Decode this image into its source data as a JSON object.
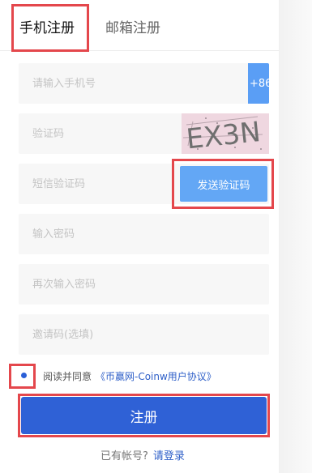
{
  "tabs": [
    {
      "label": "手机注册",
      "active": true
    },
    {
      "label": "邮箱注册",
      "active": false
    }
  ],
  "fields": {
    "phone": {
      "placeholder": "请输入手机号",
      "prefix": "+86"
    },
    "captcha": {
      "placeholder": "验证码",
      "image_text": "EX3N"
    },
    "sms": {
      "placeholder": "短信验证码",
      "button": "发送验证码"
    },
    "password": {
      "placeholder": "输入密码"
    },
    "password_confirm": {
      "placeholder": "再次输入密码"
    },
    "invite": {
      "placeholder": "邀请码(选填)"
    }
  },
  "agreement": {
    "prefix": "阅读并同意",
    "link": "《币赢网-Coinw用户协议》"
  },
  "submit_label": "注册",
  "login": {
    "question": "已有帐号?",
    "link": "请登录"
  },
  "colors": {
    "accent": "#2f61d6",
    "sms_button": "#63a7f5",
    "highlight": "#e4474c"
  }
}
